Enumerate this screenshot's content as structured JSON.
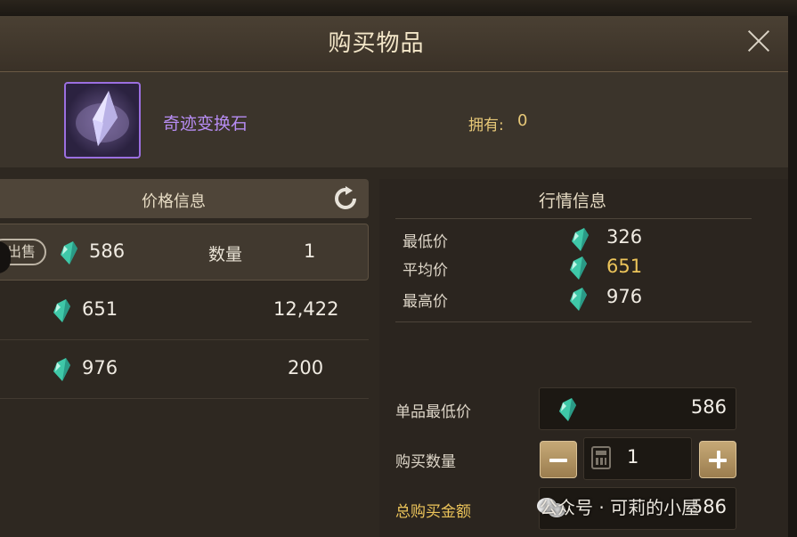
{
  "dialog": {
    "title": "购买物品"
  },
  "item": {
    "name": "奇迹变换石",
    "owned_label": "拥有:",
    "owned_value": "0"
  },
  "price_info": {
    "header": "价格信息",
    "rows": [
      {
        "action": "出售",
        "price": "586",
        "qty_label": "数量",
        "qty": "1"
      },
      {
        "price": "651",
        "qty": "12,422"
      },
      {
        "price": "976",
        "qty": "200"
      }
    ]
  },
  "market_info": {
    "header": "行情信息",
    "rows": [
      {
        "label": "最低价",
        "value": "326"
      },
      {
        "label": "平均价",
        "value": "651"
      },
      {
        "label": "最高价",
        "value": "976"
      }
    ]
  },
  "purchase": {
    "unit_min_label": "单品最低价",
    "unit_min_value": "586",
    "qty_label": "购买数量",
    "qty_value": "1",
    "total_label": "总购买金额",
    "total_value": "586"
  },
  "watermark": "公众号 · 可莉的小屋",
  "colors": {
    "gold": "#ecc45a",
    "item_purple": "#b68cf2",
    "gem": "#3fc8a8"
  }
}
